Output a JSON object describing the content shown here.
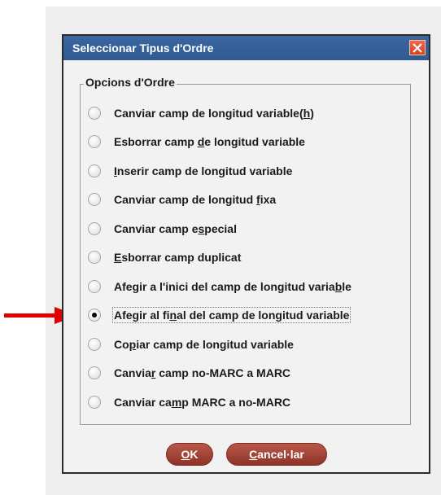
{
  "dialog": {
    "title": "Seleccionar Tipus d'Ordre",
    "group_label": "Opcions d'Ordre",
    "options": [
      {
        "pre": "Canviar camp de longitud variable(",
        "u": "h",
        "post": ")",
        "checked": false
      },
      {
        "pre": "Esborrar camp ",
        "u": "d",
        "post": "e longitud variable",
        "checked": false
      },
      {
        "pre": "",
        "u": "I",
        "post": "nserir camp de longitud variable",
        "checked": false
      },
      {
        "pre": "Canviar camp de longitud ",
        "u": "f",
        "post": "ixa",
        "checked": false
      },
      {
        "pre": "Canviar camp e",
        "u": "s",
        "post": "pecial",
        "checked": false
      },
      {
        "pre": "",
        "u": "E",
        "post": "sborrar camp duplicat",
        "checked": false
      },
      {
        "pre": "Afegir a l'inici del camp de longitud varia",
        "u": "b",
        "post": "le",
        "checked": false
      },
      {
        "pre": "Afegir al fi",
        "u": "n",
        "post": "al del camp de longitud variable",
        "checked": true
      },
      {
        "pre": "Co",
        "u": "p",
        "post": "iar camp de longitud variable",
        "checked": false
      },
      {
        "pre": "Canvia",
        "u": "r",
        "post": " camp no-MARC a MARC",
        "checked": false
      },
      {
        "pre": "Canviar ca",
        "u": "m",
        "post": "p MARC a no-MARC",
        "checked": false
      }
    ],
    "ok": {
      "u": "O",
      "rest": "K"
    },
    "cancel": {
      "u": "C",
      "rest": "ancel·lar"
    }
  },
  "colors": {
    "title_bar": "#2f5a92",
    "button": "#a3463a",
    "close": "#e0502c",
    "arrow": "#e00000"
  }
}
